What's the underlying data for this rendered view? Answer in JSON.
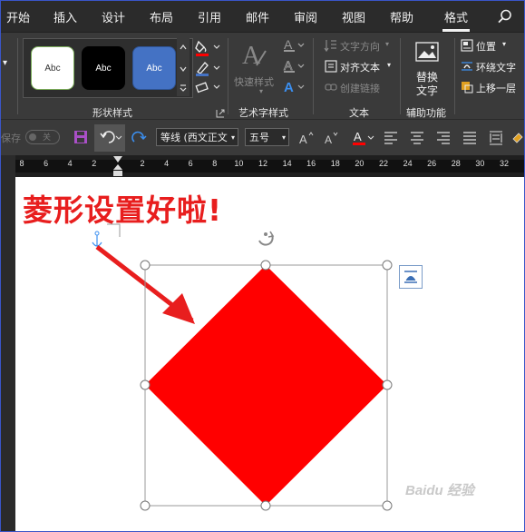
{
  "tabs": [
    "开始",
    "插入",
    "设计",
    "布局",
    "引用",
    "邮件",
    "审阅",
    "视图",
    "帮助",
    "格式"
  ],
  "active_tab": "格式",
  "ribbon": {
    "shape_styles": {
      "label": "形状样式",
      "samples": [
        "Abc",
        "Abc",
        "Abc"
      ]
    },
    "wordart": {
      "label": "艺术字样式",
      "quick_styles": "快速样式"
    },
    "text": {
      "label": "文本",
      "direction": "文字方向",
      "align": "对齐文本",
      "link": "创建链接"
    },
    "accessibility": {
      "label": "辅助功能",
      "alt_text_1": "替换",
      "alt_text_2": "文字"
    },
    "arrange": {
      "position": "位置",
      "wrap": "环绕文字",
      "forward": "上移一层"
    }
  },
  "qat": {
    "autosave": "保存",
    "toggle": "关",
    "font": "等线 (西文正文",
    "size": "五号"
  },
  "ruler": {
    "labels": [
      "8",
      "6",
      "4",
      "2",
      "2",
      "4",
      "6",
      "8",
      "10",
      "12",
      "14",
      "16",
      "18",
      "20",
      "22",
      "24",
      "26",
      "28",
      "30",
      "32"
    ]
  },
  "document": {
    "annotation": "菱形设置好啦!",
    "watermark": "Baidu 经验"
  },
  "colors": {
    "accent_red": "#ff0000",
    "shape_fill": "#ff0000",
    "ribbon_bg": "#3a3a3a"
  }
}
